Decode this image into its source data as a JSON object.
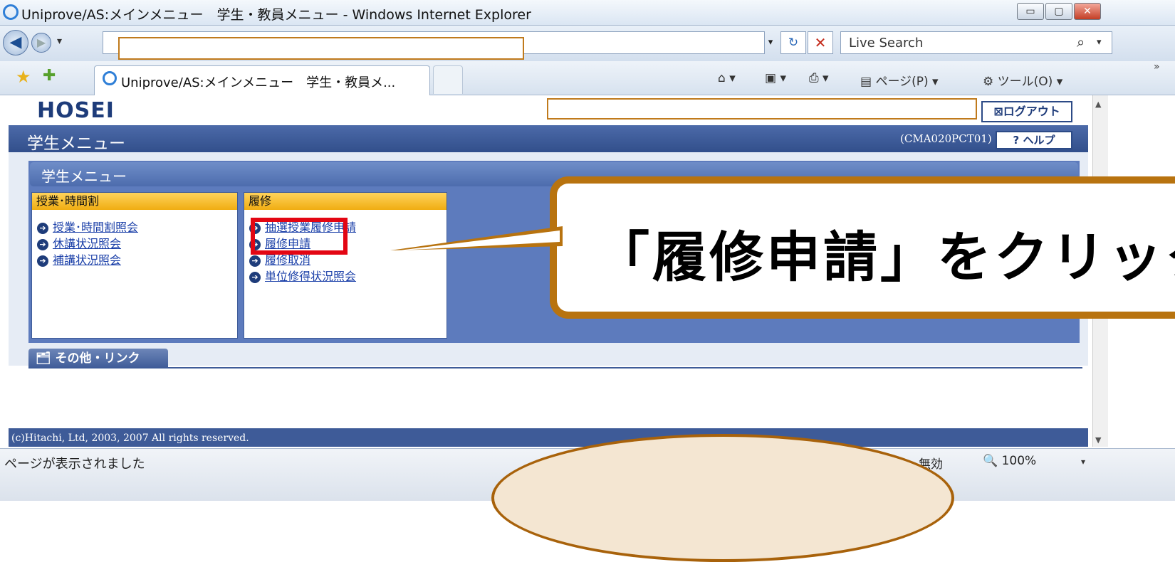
{
  "window": {
    "title": "Uniprove/AS:メインメニュー　学生・教員メニュー - Windows Internet Explorer",
    "min_label": "▭",
    "max_label": "▢",
    "close_label": "✕"
  },
  "address_bar": {
    "back_label": "◀",
    "forward_label": "▶",
    "dropdown_label": "▾",
    "url_dropdown_label": "▾",
    "refresh_label": "↻",
    "stop_label": "✕",
    "search_placeholder": "Live Search",
    "search_icon": "⌕",
    "search_dropdown": "▾"
  },
  "command_bar": {
    "fav_icon": "★",
    "add_fav_icon": "✚",
    "tab_label": "Uniprove/AS:メインメニュー　学生・教員メ...",
    "home": "⌂ ▾",
    "feeds": "▣ ▾",
    "print": "⎙ ▾",
    "page_menu": "▤ ページ(P) ▾",
    "tools_menu": "⚙ ツール(O) ▾",
    "chevron": "»"
  },
  "header": {
    "logo": "HOSEI",
    "logout_label": "⊠ログアウト",
    "page_title": "学生メニュー",
    "screen_id": "(CMA020PCT01)",
    "help_label": "? ヘルプ"
  },
  "panel": {
    "title": "学生メニュー",
    "boxes": [
      {
        "title": "授業･時間割",
        "links": [
          "授業･時間割照会",
          "休講状況照会",
          "補講状況照会"
        ]
      },
      {
        "title": "履修",
        "links": [
          "抽選授業履修申請",
          "履修申請",
          "履修取消",
          "単位修得状況照会"
        ]
      }
    ]
  },
  "other": {
    "tab_label": "🗂 その他・リンク"
  },
  "footer": {
    "copyright": "(c)Hitachi, Ltd, 2003, 2007 All rights reserved."
  },
  "status": {
    "text": "ページが表示されました",
    "mode": "無効",
    "zoom": "🔍 100%",
    "zoom_dd": "▾"
  },
  "callout": {
    "text": "「履修申請」をクリック"
  }
}
